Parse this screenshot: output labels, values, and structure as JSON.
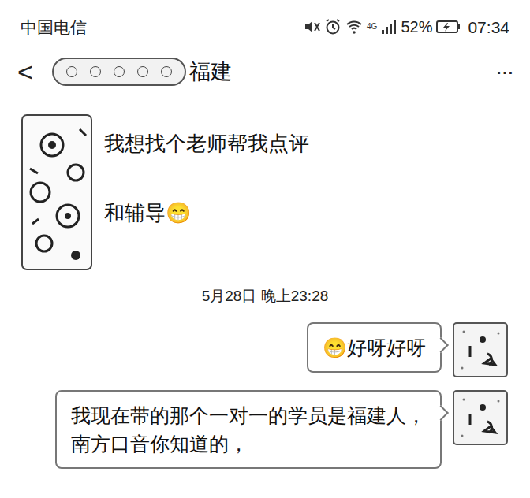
{
  "status_bar": {
    "carrier": "中国电信",
    "network": "4G",
    "battery": "52%",
    "charging": true,
    "time": "07:34"
  },
  "header": {
    "back": "<",
    "title": "福建",
    "more": "···"
  },
  "messages": [
    {
      "kind": "text",
      "side": "left",
      "lines": [
        "我想找个老师帮我点评",
        "和辅导😁"
      ]
    },
    {
      "kind": "timestamp",
      "text": "5月28日 晚上23:28"
    },
    {
      "kind": "text",
      "side": "right",
      "lines": [
        "😁好呀好呀"
      ]
    },
    {
      "kind": "text",
      "side": "right",
      "lines": [
        "我现在带的那个一对一的学员是福建人，南方口音你知道的，"
      ]
    }
  ]
}
